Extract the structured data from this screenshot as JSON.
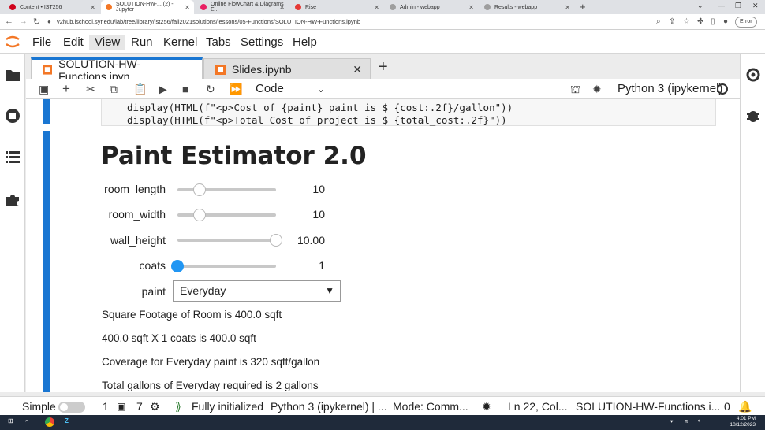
{
  "browser": {
    "tabs": [
      {
        "title": "Content • IST256",
        "color": "#d0021b",
        "active": false
      },
      {
        "title": "SOLUTION-HW-... (2) - Jupyter",
        "color": "#f37726",
        "active": true
      },
      {
        "title": "Online FlowChart & Diagrams E...",
        "color": "#e91e63",
        "active": false
      },
      {
        "title": "Rise",
        "color": "#e53935",
        "active": false
      },
      {
        "title": "Admin - webapp",
        "color": "#9e9e9e",
        "active": false
      },
      {
        "title": "Results - webapp",
        "color": "#9e9e9e",
        "active": false
      }
    ],
    "url": "v2hub.ischool.syr.edu/lab/tree/library/ist256/fall2021solutions/lessons/05-Functions/SOLUTION-HW-Functions.ipynb",
    "error_label": "Error"
  },
  "menu": [
    "File",
    "Edit",
    "View",
    "Run",
    "Kernel",
    "Tabs",
    "Settings",
    "Help"
  ],
  "notebook_tabs": [
    {
      "title": "SOLUTION-HW-Functions.ipyn",
      "active": true
    },
    {
      "title": "Slides.ipynb",
      "active": false
    }
  ],
  "toolbar": {
    "cell_type": "Code",
    "kernel_name": "Python 3 (ipykernel)"
  },
  "code_lines": [
    "display(HTML(f\"<p>Cost of {paint} paint is $ {cost:.2f}/gallon\"))",
    "display(HTML(f\"<p>Total Cost of project is $ {total_cost:.2f}\"))"
  ],
  "output": {
    "heading": "Paint Estimator 2.0",
    "sliders": [
      {
        "label": "room_length",
        "value": "10",
        "level": 0.22,
        "active": false
      },
      {
        "label": "room_width",
        "value": "10",
        "level": 0.22,
        "active": false
      },
      {
        "label": "wall_height",
        "value": "10.00",
        "level": 1.0,
        "active": false
      },
      {
        "label": "coats",
        "value": "1",
        "level": 0.0,
        "active": true
      }
    ],
    "dropdown_label": "paint",
    "dropdown_value": "Everyday",
    "lines": [
      "Square Footage of Room is 400.0 sqft",
      "400.0 sqft X 1 coats is 400.0 sqft",
      "Coverage for Everyday paint is 320 sqft/gallon",
      "Total gallons of Everyday required is 2 gallons"
    ]
  },
  "status": {
    "mode_label": "Simple",
    "terminals": "1",
    "kernels": "7",
    "kernel_state": "Fully initialized",
    "kernel_info": "Python 3 (ipykernel) | ...",
    "mode": "Mode: Comm...",
    "cursor": "Ln 22, Col...",
    "file": "SOLUTION-HW-Functions.i...",
    "notifications": "0"
  },
  "taskbar": {
    "time": "4:01 PM",
    "date": "10/12/2023"
  }
}
